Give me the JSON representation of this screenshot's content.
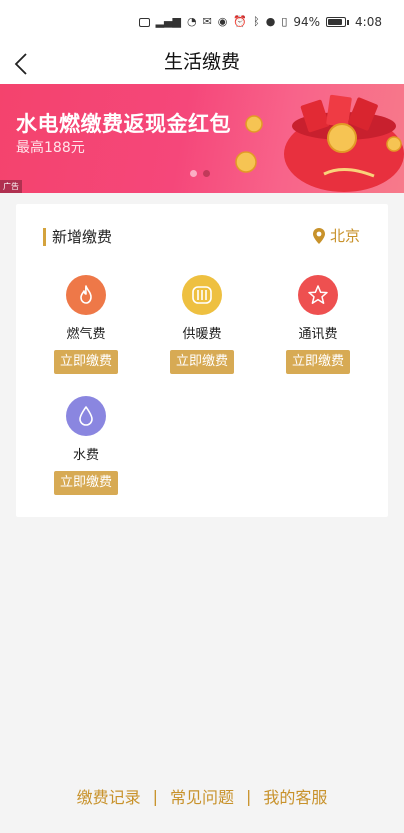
{
  "status_bar": {
    "battery": "94%",
    "time": "4:08"
  },
  "header": {
    "title": "生活缴费"
  },
  "banner": {
    "title": "水电燃缴费返现金红包",
    "subtitle": "最高188元",
    "ad_tag": "广告",
    "colors": {
      "start": "#f4436d",
      "end": "#f77a8a"
    }
  },
  "card": {
    "title": "新增缴费",
    "city": "北京",
    "accent": "#d7aa54",
    "items": [
      {
        "label": "燃气费",
        "button": "立即缴费",
        "icon": "flame-icon",
        "color": "#ee7848"
      },
      {
        "label": "供暖费",
        "button": "立即缴费",
        "icon": "radiator-icon",
        "color": "#eec040"
      },
      {
        "label": "通讯费",
        "button": "立即缴费",
        "icon": "star-icon",
        "color": "#ee5050"
      },
      {
        "label": "水费",
        "button": "立即缴费",
        "icon": "water-drop-icon",
        "color": "#8a86e0"
      }
    ]
  },
  "footer": {
    "links": [
      "缴费记录",
      "常见问题",
      "我的客服"
    ],
    "separator": "|"
  }
}
